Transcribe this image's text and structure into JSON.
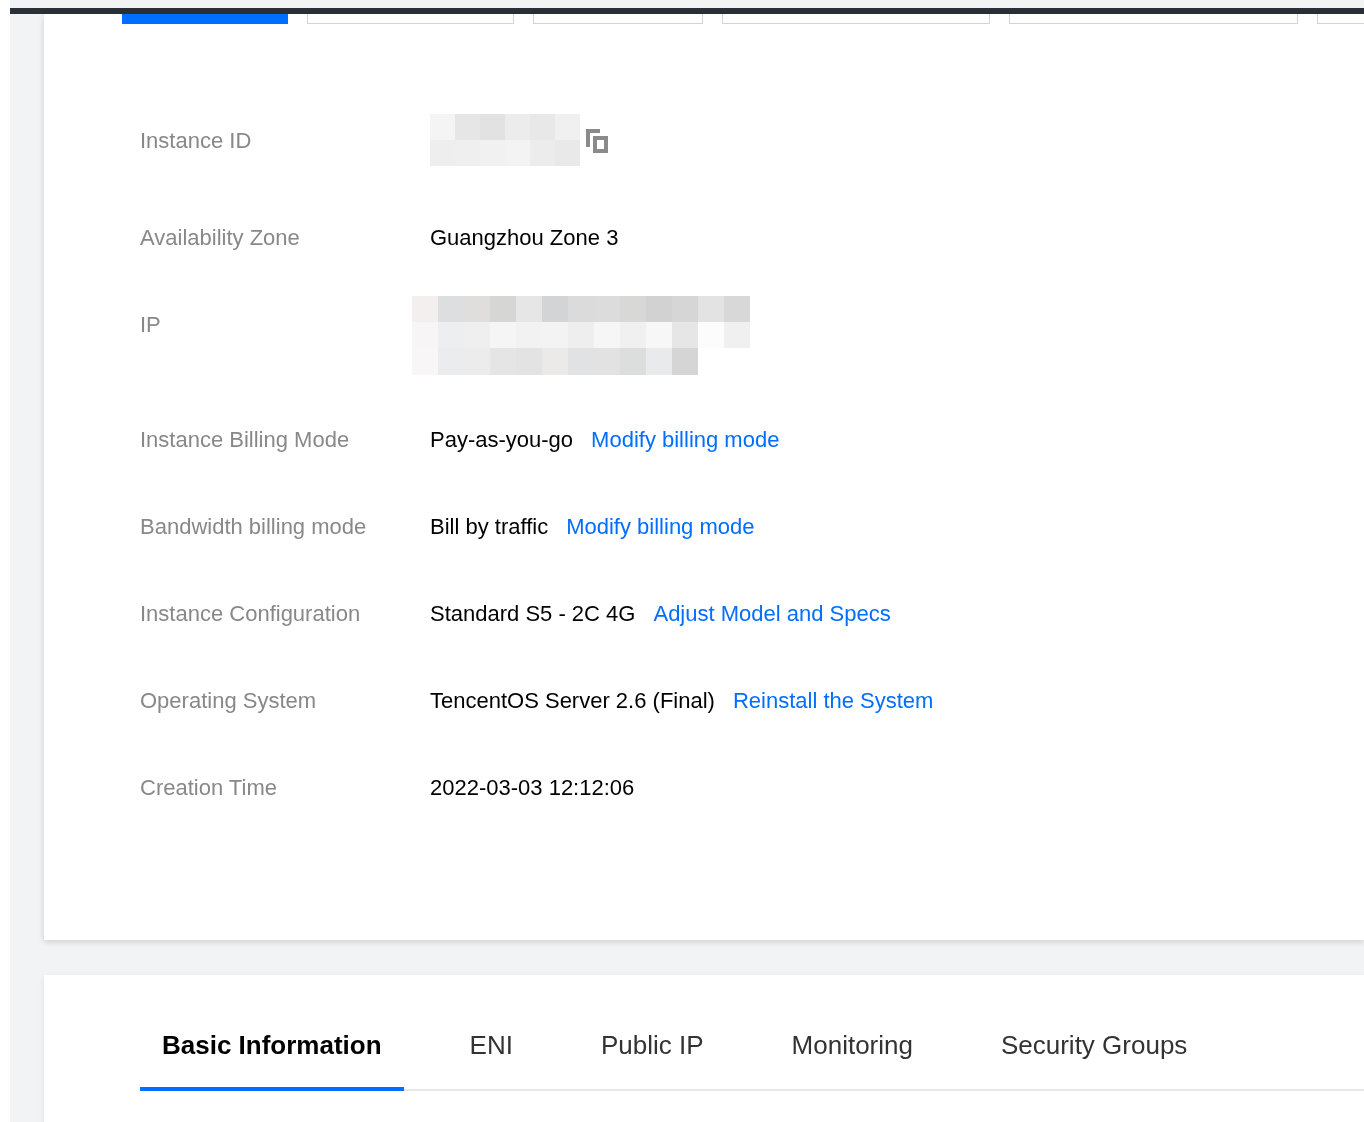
{
  "top_tabs": [
    {
      "selected": true
    },
    {
      "selected": false
    },
    {
      "selected": false
    },
    {
      "selected": false
    },
    {
      "selected": false
    },
    {
      "selected": false
    }
  ],
  "details": [
    {
      "label": "Instance ID",
      "kind": "redacted_id"
    },
    {
      "label": "Availability Zone",
      "kind": "text",
      "value": "Guangzhou Zone 3"
    },
    {
      "label": "IP",
      "kind": "redacted_ip"
    },
    {
      "label": "Instance Billing Mode",
      "kind": "text",
      "value": "Pay-as-you-go",
      "link": "Modify billing mode"
    },
    {
      "label": "Bandwidth billing mode",
      "kind": "text",
      "value": "Bill by traffic",
      "link": "Modify billing mode"
    },
    {
      "label": "Instance Configuration",
      "kind": "text",
      "value": "Standard S5 - 2C 4G",
      "link": "Adjust Model and Specs"
    },
    {
      "label": "Operating System",
      "kind": "text",
      "value": "TencentOS Server 2.6 (Final)",
      "link": "Reinstall the System"
    },
    {
      "label": "Creation Time",
      "kind": "text",
      "value": "2022-03-03 12:12:06"
    }
  ],
  "tabs": [
    {
      "label": "Basic Information",
      "selected": true
    },
    {
      "label": "ENI",
      "selected": false
    },
    {
      "label": "Public IP",
      "selected": false
    },
    {
      "label": "Monitoring",
      "selected": false
    },
    {
      "label": "Security Groups",
      "selected": false
    }
  ]
}
